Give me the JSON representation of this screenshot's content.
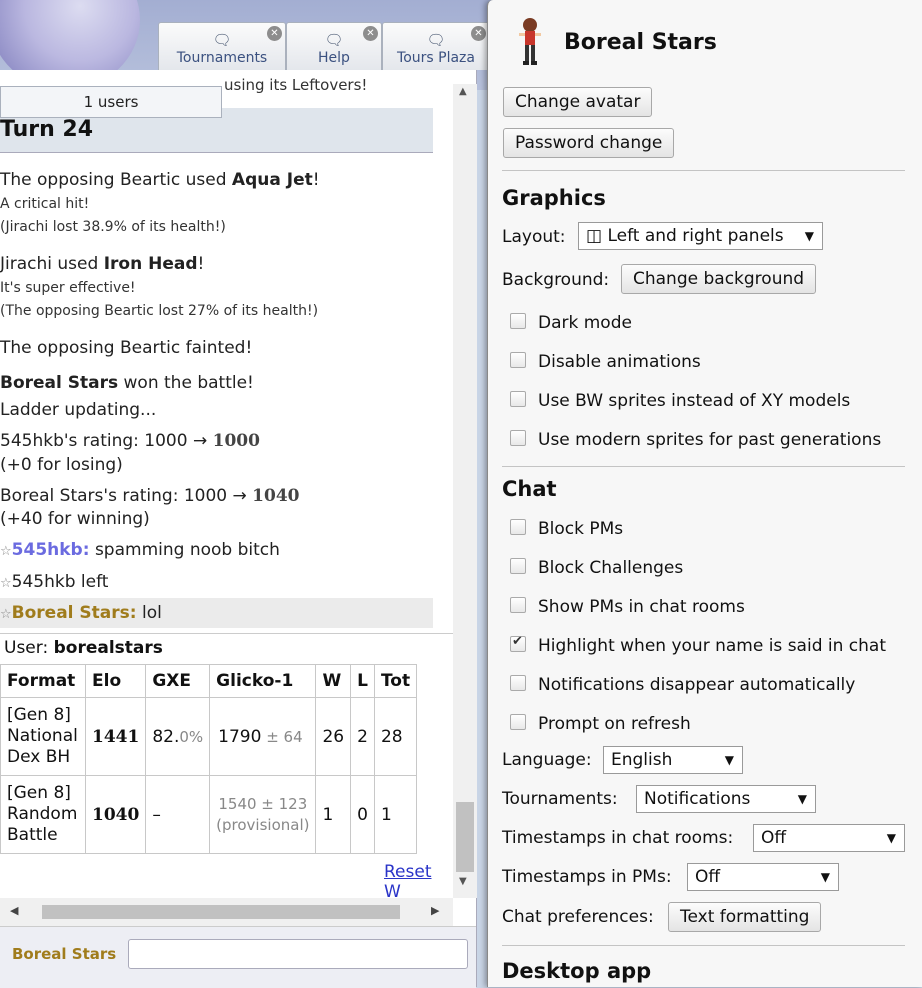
{
  "tabs": [
    {
      "label": "Tournaments"
    },
    {
      "label": "Help"
    },
    {
      "label": "Tours Plaza"
    }
  ],
  "battle": {
    "users": "1 users",
    "prev_text": "using its Leftovers!",
    "turn": "Turn 24",
    "lines": {
      "l1a": "The opposing Beartic used ",
      "l1b": "Aqua Jet",
      "l1c": "!",
      "l2": "A critical hit!",
      "l3": "(Jirachi lost 38.9% of its health!)",
      "l4a": "Jirachi used ",
      "l4b": "Iron Head",
      "l4c": "!",
      "l5": "It's super effective!",
      "l6": "(The opposing Beartic lost 27% of its health!)",
      "l7": "The opposing Beartic fainted!",
      "l8a": "Boreal Stars",
      "l8b": " won the battle!",
      "l9": "Ladder updating...",
      "l10a": "545hkb's rating: 1000 → ",
      "l10b": "1000",
      "l11": "(+0 for losing)",
      "l12a": "Boreal Stars's rating: 1000 → ",
      "l12b": "1040",
      "l13": "(+40 for winning)"
    },
    "chat": [
      {
        "star": "☆",
        "user": "545hkb:",
        "msg": "spamming noob bitch"
      },
      {
        "star": "☆",
        "user": "545hkb left",
        "msg": ""
      },
      {
        "star": "☆",
        "user": "Boreal Stars:",
        "msg": "lol"
      }
    ],
    "user_label": "User: ",
    "user_name": "borealstars",
    "table": {
      "headers": [
        "Format",
        "Elo",
        "GXE",
        "Glicko-1",
        "W",
        "L",
        "Tot"
      ],
      "rows": [
        {
          "format": "[Gen 8] National Dex BH",
          "elo": "1441",
          "gxe": "82.",
          "gxe_dec": "0%",
          "glicko": "1790",
          "glicko_dev": " ± 64",
          "w": "26",
          "l": "2",
          "t": "28"
        },
        {
          "format": "[Gen 8] Random Battle",
          "elo": "1040",
          "gxe": "–",
          "gxe_dec": "",
          "glicko": "1540 ± 123",
          "glicko_dev": "(provisional)",
          "w": "1",
          "l": "0",
          "t": "1"
        }
      ]
    },
    "reset": "Reset W",
    "chat_name": "Boreal Stars"
  },
  "options": {
    "name": "Boreal Stars",
    "change_avatar": "Change avatar",
    "password_change": "Password change",
    "graphics": "Graphics",
    "layout_label": "Layout:",
    "layout_value": "◫ Left and right panels",
    "background_label": "Background:",
    "change_background": "Change background",
    "graphics_checks": [
      {
        "label": "Dark mode",
        "checked": false
      },
      {
        "label": "Disable animations",
        "checked": false
      },
      {
        "label": "Use BW sprites instead of XY models",
        "checked": false
      },
      {
        "label": "Use modern sprites for past generations",
        "checked": false
      }
    ],
    "chat": "Chat",
    "chat_checks": [
      {
        "label": "Block PMs",
        "checked": false
      },
      {
        "label": "Block Challenges",
        "checked": false
      },
      {
        "label": "Show PMs in chat rooms",
        "checked": false
      },
      {
        "label": "Highlight when your name is said in chat",
        "checked": true
      },
      {
        "label": "Notifications disappear automatically",
        "checked": false
      },
      {
        "label": "Prompt on refresh",
        "checked": false
      }
    ],
    "language_label": "Language:",
    "language_value": "English",
    "tournaments_label": "Tournaments:",
    "tournaments_value": "Notifications",
    "ts_rooms_label": "Timestamps in chat rooms:",
    "ts_rooms_value": "Off",
    "ts_pms_label": "Timestamps in PMs:",
    "ts_pms_value": "Off",
    "chatpref_label": "Chat preferences:",
    "text_formatting": "Text formatting",
    "desktop": "Desktop app"
  }
}
